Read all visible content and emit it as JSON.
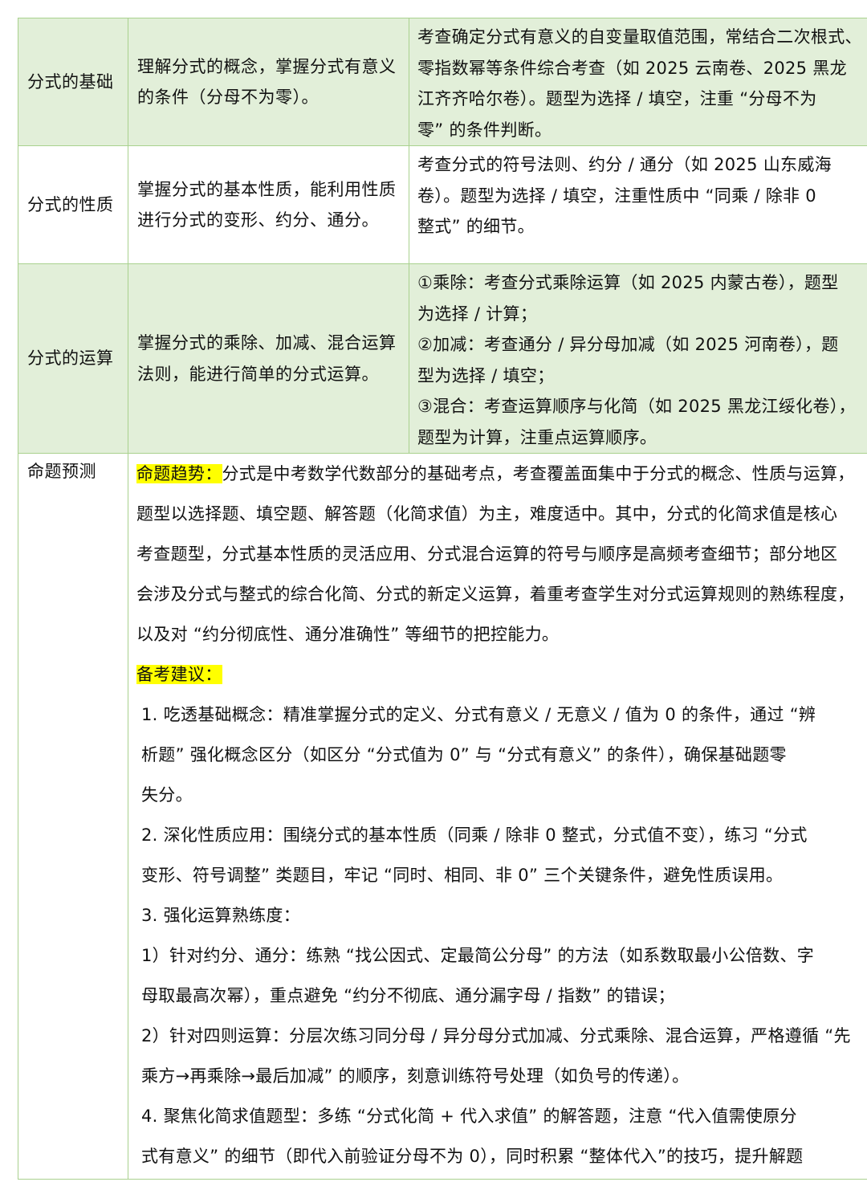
{
  "rows": [
    {
      "name": "分式的基础",
      "goal": "理解分式的概念，掌握分式有意义的条件（分母不为零）。",
      "req_lines": [
        "考查确定分式有意义的自变量取值范围，常结合二次根式、",
        "零指数幂等条件综合考查（如 2025 云南卷、2025 黑龙",
        "江齐齐哈尔卷）。题型为选择 / 填空，注重 “分母不为",
        "零” 的条件判断。"
      ]
    },
    {
      "name": "分式的性质",
      "goal": "掌握分式的基本性质，能利用性质进行分式的变形、约分、通分。",
      "req_lines": [
        "考查分式的符号法则、约分 / 通分（如 2025 山东威海",
        "卷）。题型为选择 / 填空，注重性质中 “同乘 / 除非 0",
        "整式” 的细节。"
      ]
    },
    {
      "name": "分式的运算",
      "goal": "掌握分式的乘除、加减、混合运算法则，能进行简单的分式运算。",
      "req_lines": [
        "①乘除：考查分式乘除运算（如 2025 内蒙古卷），题型",
        "为选择 / 计算；",
        "②加减：考查通分 / 异分母加减（如 2025 河南卷），题",
        "型为选择 / 填空；",
        "③混合：考查运算顺序与化简（如 2025 黑龙江绥化卷），",
        "题型为计算，注重点运算顺序。"
      ]
    }
  ],
  "prediction": {
    "label": "命题预测",
    "trend_title": "命题趋势：",
    "trend_first": "分式是中考数学代数部分的基础考点，考查覆盖面集中于分式的概念、性质与运算，",
    "trend_lines": [
      "题型以选择题、填空题、解答题（化简求值）为主，难度适中。其中，分式的化简求值是核心",
      "考查题型，分式基本性质的灵活应用、分式混合运算的符号与顺序是高频考查细节；部分地区",
      "会涉及分式与整式的综合化简、分式的新定义运算，着重考查学生对分式运算规则的熟练程度，",
      "以及对 “约分彻底性、通分准确性” 等细节的把控能力。"
    ],
    "advice_title": "备考建议：",
    "advice_lines": [
      "1. 吃透基础概念：精准掌握分式的定义、分式有意义 / 无意义 / 值为 0 的条件，通过 “辨",
      "析题” 强化概念区分（如区分 “分式值为 0” 与 “分式有意义” 的条件），确保基础题零",
      "失分。",
      "2. 深化性质应用：围绕分式的基本性质（同乘 / 除非 0 整式，分式值不变），练习 “分式",
      "变形、符号调整” 类题目，牢记 “同时、相同、非 0” 三个关键条件，避免性质误用。",
      "3. 强化运算熟练度：",
      "1）针对约分、通分：练熟 “找公因式、定最简公分母” 的方法（如系数取最小公倍数、字",
      "母取最高次幂），重点避免 “约分不彻底、通分漏字母 / 指数” 的错误；",
      "2）针对四则运算：分层次练习同分母 / 异分母分式加减、分式乘除、混合运算，严格遵循 “先",
      "乘方→再乘除→最后加减” 的顺序，刻意训练符号处理（如负号的传递）。",
      "4. 聚焦化简求值题型：多练 “分式化简 + 代入求值” 的解答题，注意 “代入值需使原分",
      "式有意义” 的细节（即代入前验证分母不为 0），同时积累 “整体代入”的技巧，提升解题"
    ]
  },
  "colors": {
    "row_fill": "#e2efd9",
    "border": "#a9d18e",
    "highlight": "#ffff00"
  }
}
